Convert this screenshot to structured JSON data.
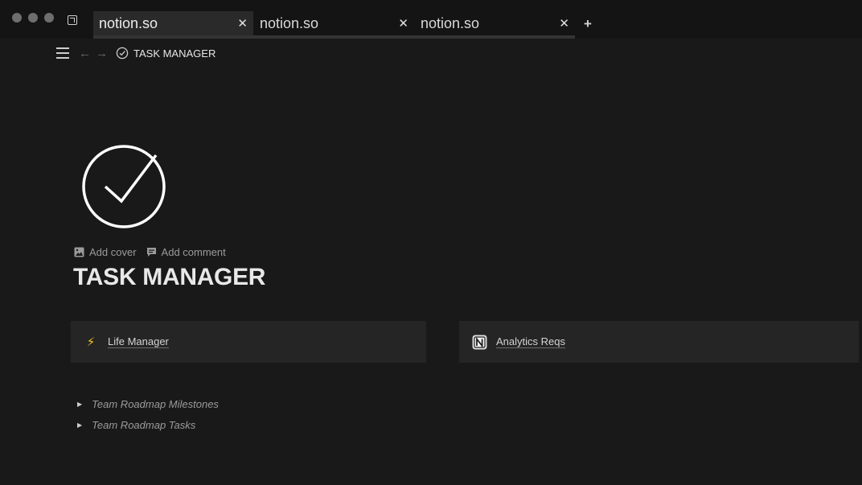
{
  "browser": {
    "tabs": [
      {
        "title": "notion.so",
        "active": true
      },
      {
        "title": "notion.so",
        "active": false
      },
      {
        "title": "notion.so",
        "active": false
      }
    ],
    "close_glyph": "✕",
    "new_tab_glyph": "+"
  },
  "nav": {
    "back_glyph": "←",
    "forward_glyph": "→",
    "breadcrumb": "TASK MANAGER"
  },
  "page": {
    "icon": "check-circle-icon",
    "actions": {
      "add_cover": "Add cover",
      "add_comment": "Add comment"
    },
    "title": "TASK MANAGER",
    "links": [
      {
        "label": "Life Manager",
        "icon": "lightning-icon",
        "glyph": "⚡"
      },
      {
        "label": "Analytics Reqs",
        "icon": "notion-logo-icon"
      }
    ],
    "toggles": [
      {
        "label": "Team Roadmap Milestones"
      },
      {
        "label": "Team Roadmap Tasks"
      }
    ],
    "toggle_glyph": "▶"
  },
  "colors": {
    "background": "#191919",
    "card": "#252525",
    "titlebar": "#141414"
  }
}
